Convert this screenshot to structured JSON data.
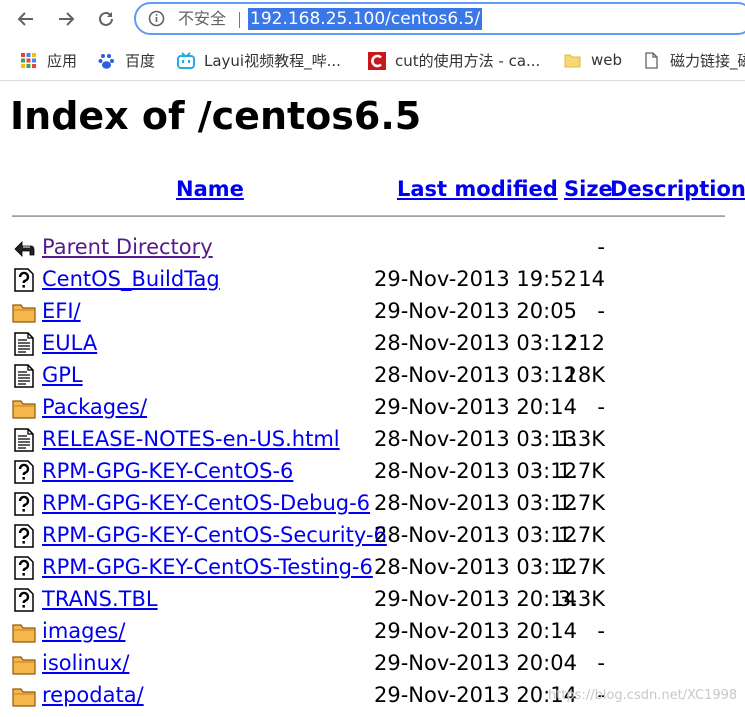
{
  "browser": {
    "insecure_label": "不安全",
    "url": "192.168.25.100/centos6.5/",
    "bookmarks": [
      {
        "label": "应用",
        "icon": "apps-grid-icon"
      },
      {
        "label": "百度",
        "icon": "baidu-paw-icon"
      },
      {
        "label": "Layui视频教程_哔...",
        "icon": "bilibili-tv-icon"
      },
      {
        "label": "cut的使用方法 - ca...",
        "icon": "csdn-c-icon"
      },
      {
        "label": "web",
        "icon": "folder-icon"
      },
      {
        "label": "磁力链接_磁",
        "icon": "page-icon"
      }
    ]
  },
  "page": {
    "title": "Index of /centos6.5",
    "columns": {
      "name": "Name",
      "modified": "Last modified",
      "size": "Size",
      "description": "Description"
    },
    "entries": [
      {
        "name": "Parent Directory",
        "date": "",
        "size": "-",
        "icon": "back",
        "visited": true
      },
      {
        "name": "CentOS_BuildTag",
        "date": "29-Nov-2013 19:52",
        "size": "14",
        "icon": "unknown"
      },
      {
        "name": "EFI/",
        "date": "29-Nov-2013 20:05",
        "size": "-",
        "icon": "folder"
      },
      {
        "name": "EULA",
        "date": "28-Nov-2013 03:12",
        "size": "212",
        "icon": "text"
      },
      {
        "name": "GPL",
        "date": "28-Nov-2013 03:12",
        "size": "18K",
        "icon": "text"
      },
      {
        "name": "Packages/",
        "date": "29-Nov-2013 20:14",
        "size": "-",
        "icon": "folder"
      },
      {
        "name": "RELEASE-NOTES-en-US.html",
        "date": "28-Nov-2013 03:13",
        "size": "1.3K",
        "icon": "text"
      },
      {
        "name": "RPM-GPG-KEY-CentOS-6",
        "date": "28-Nov-2013 03:12",
        "size": "1.7K",
        "icon": "unknown"
      },
      {
        "name": "RPM-GPG-KEY-CentOS-Debug-6",
        "date": "28-Nov-2013 03:12",
        "size": "1.7K",
        "icon": "unknown"
      },
      {
        "name": "RPM-GPG-KEY-CentOS-Security-6",
        "date": "28-Nov-2013 03:12",
        "size": "1.7K",
        "icon": "unknown"
      },
      {
        "name": "RPM-GPG-KEY-CentOS-Testing-6",
        "date": "28-Nov-2013 03:12",
        "size": "1.7K",
        "icon": "unknown"
      },
      {
        "name": "TRANS.TBL",
        "date": "29-Nov-2013 20:14",
        "size": "3.3K",
        "icon": "unknown"
      },
      {
        "name": "images/",
        "date": "29-Nov-2013 20:14",
        "size": "-",
        "icon": "folder"
      },
      {
        "name": "isolinux/",
        "date": "29-Nov-2013 20:04",
        "size": "-",
        "icon": "folder"
      },
      {
        "name": "repodata/",
        "date": "29-Nov-2013 20:14",
        "size": "-",
        "icon": "folder"
      }
    ]
  },
  "watermark": "https://blog.csdn.net/XC1998"
}
